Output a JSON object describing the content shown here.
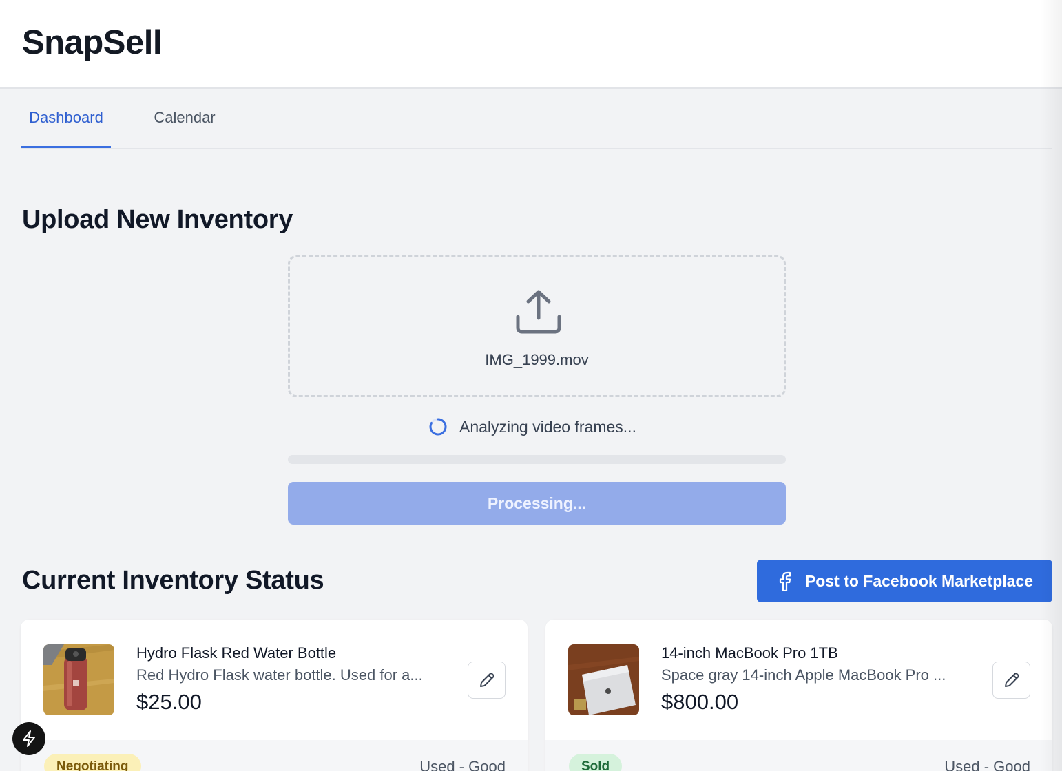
{
  "header": {
    "app_title": "SnapSell"
  },
  "tabs": [
    {
      "label": "Dashboard",
      "active": true
    },
    {
      "label": "Calendar",
      "active": false
    }
  ],
  "upload": {
    "title": "Upload New Inventory",
    "file_name": "IMG_1999.mov",
    "status_text": "Analyzing video frames...",
    "progress": 0,
    "button_label": "Processing...",
    "icon": "upload-icon"
  },
  "inventory": {
    "title": "Current Inventory Status",
    "post_button_label": "Post to Facebook Marketplace",
    "post_button_icon": "facebook-icon",
    "items": [
      {
        "title": "Hydro Flask Red Water Bottle",
        "description": "Red Hydro Flask water bottle. Used for a...",
        "price": "$25.00",
        "status": "Negotiating",
        "condition": "Used - Good",
        "thumbnail": "water-bottle-photo"
      },
      {
        "title": "14-inch MacBook Pro 1TB",
        "description": "Space gray 14-inch Apple MacBook Pro ...",
        "price": "$800.00",
        "status": "Sold",
        "condition": "Used - Good",
        "thumbnail": "laptop-photo"
      }
    ]
  },
  "colors": {
    "accent": "#3b6fe0",
    "button_disabled": "#93abea",
    "facebook_button": "#2f6bdd",
    "badge_negotiating": "#fbf0b8",
    "badge_sold": "#d5f2dc",
    "background": "#f2f3f5"
  }
}
